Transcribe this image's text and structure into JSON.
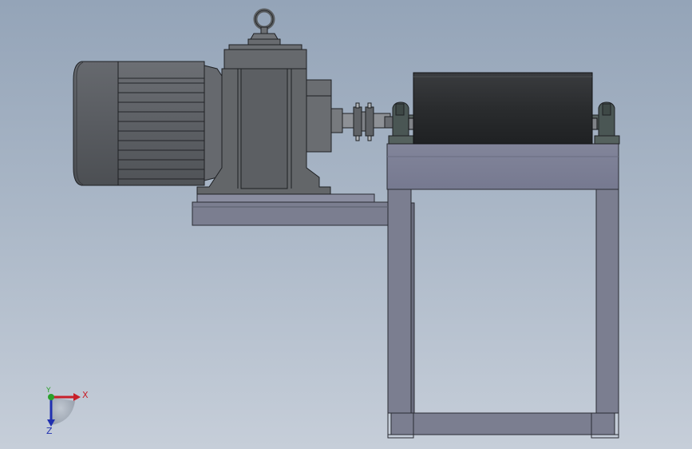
{
  "viewport": {
    "background_top": "#94a4b8",
    "background_bottom": "#c6ced9"
  },
  "triad": {
    "x_label": "X",
    "y_label": "Y",
    "z_label": "Z",
    "x_color": "#c8202a",
    "y_color": "#2aa02a",
    "z_color": "#2030b0"
  },
  "model": {
    "parts": [
      "motor",
      "gear-reducer",
      "eye-bolt",
      "coupling",
      "drum-roller",
      "bearing-block-left",
      "bearing-block-right",
      "motor-base-plate",
      "frame-stand"
    ],
    "colors": {
      "motor_body": "#5b5e63",
      "housing": "#646769",
      "drum": "#2a2c2e",
      "frame": "#7c7f8f",
      "bearing": "#4a5654"
    }
  }
}
